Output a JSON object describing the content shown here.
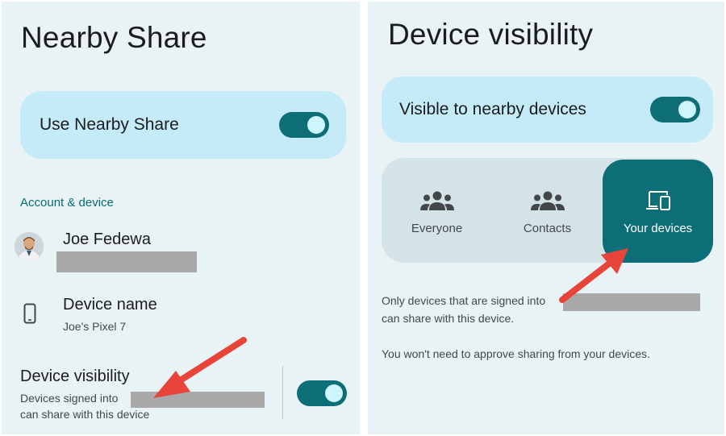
{
  "left": {
    "title": "Nearby Share",
    "use_toggle": {
      "label": "Use Nearby Share",
      "on": true
    },
    "section_header": "Account & device",
    "account": {
      "name": "Joe Fedewa"
    },
    "device_name": {
      "label": "Device name",
      "value": "Joe's Pixel 7"
    },
    "visibility": {
      "label": "Device visibility",
      "line1": "Devices signed into",
      "line2": "can share with this device",
      "on": true
    }
  },
  "right": {
    "title": "Device visibility",
    "visible_toggle": {
      "label": "Visible to nearby devices",
      "on": true
    },
    "options": [
      {
        "label": "Everyone",
        "icon": "group-icon",
        "selected": false
      },
      {
        "label": "Contacts",
        "icon": "group-icon",
        "selected": false
      },
      {
        "label": "Your devices",
        "icon": "devices-icon",
        "selected": true
      }
    ],
    "info1_line1": "Only devices that are signed into",
    "info1_line2": "can share with this device.",
    "info2": "You won't need to approve sharing from your devices."
  },
  "colors": {
    "panel_bg": "#e9f3f6",
    "card_bg": "#c5ebf9",
    "accent": "#0e6e78",
    "segment_bg": "#d4e3e8",
    "arrow": "#e8443a",
    "redaction": "#a9a9a9"
  }
}
